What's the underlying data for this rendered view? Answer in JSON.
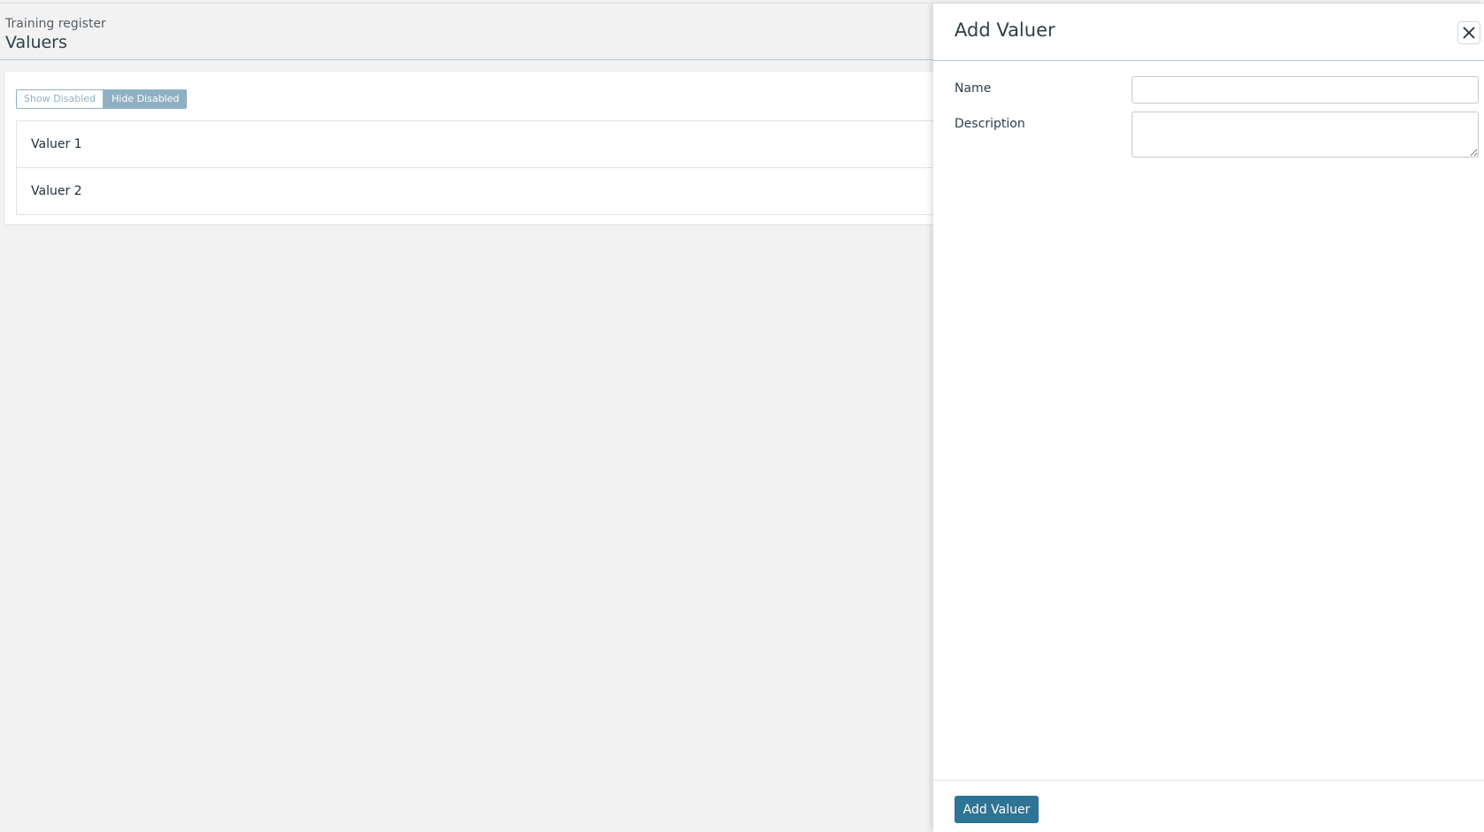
{
  "header": {
    "breadcrumb": "Training register",
    "title": "Valuers"
  },
  "filters": {
    "show_disabled_label": "Show Disabled",
    "hide_disabled_label": "Hide Disabled",
    "active": "Hide Disabled"
  },
  "valuers": [
    {
      "name": "Valuer 1"
    },
    {
      "name": "Valuer 2"
    }
  ],
  "panel": {
    "title": "Add Valuer",
    "close_icon": "close-icon",
    "form": {
      "name_label": "Name",
      "name_value": "",
      "description_label": "Description",
      "description_value": ""
    },
    "submit_label": "Add Valuer"
  },
  "colors": {
    "accent": "#2f7395",
    "toggle_active": "#8fb0c2",
    "header_border": "#a8cbe0",
    "background": "#f2f2f2"
  }
}
